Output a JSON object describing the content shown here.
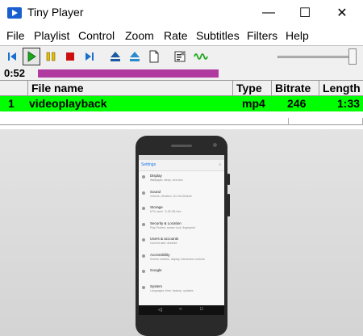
{
  "window": {
    "title": "Tiny Player",
    "minimize_glyph": "—",
    "maximize_glyph": "☐",
    "close_glyph": "✕"
  },
  "menu": [
    "File",
    "Playlist",
    "Control",
    "Zoom",
    "Rate",
    "Subtitles",
    "Filters",
    "Help"
  ],
  "toolbar": {
    "icons": [
      "skip-back-icon",
      "play-icon",
      "pause-icon",
      "stop-icon",
      "skip-forward-icon",
      "eject-icon",
      "open-icon",
      "new-file-icon",
      "properties-icon",
      "waveform-icon"
    ],
    "pressed": "play-icon",
    "volume_level": 0.92
  },
  "position": {
    "time": "0:52",
    "progress_color": "#b03aa0"
  },
  "playlist": {
    "columns": [
      "File name",
      "Type",
      "Bitrate",
      "Length"
    ],
    "rows": [
      {
        "index": "1",
        "name": "videoplayback",
        "type": "mp4",
        "bitrate": "246",
        "length": "1:33"
      }
    ],
    "active_row_color": "#00ff00"
  },
  "video": {
    "screen_title": "Settings",
    "settings": [
      {
        "title": "Display",
        "sub": "Wallpaper, sleep, font size"
      },
      {
        "title": "Sound",
        "sub": "Volume, vibration, Do Not Disturb"
      },
      {
        "title": "Storage",
        "sub": "67% used · 5.25 GB free"
      },
      {
        "title": "Security & Location",
        "sub": "Play Protect, screen lock, fingerprint"
      },
      {
        "title": "Users & accounts",
        "sub": "Current user: Android"
      },
      {
        "title": "Accessibility",
        "sub": "Screen readers, display, interaction controls"
      },
      {
        "title": "Google",
        "sub": ""
      },
      {
        "title": "System",
        "sub": "Languages, time, backup, updates"
      }
    ]
  }
}
